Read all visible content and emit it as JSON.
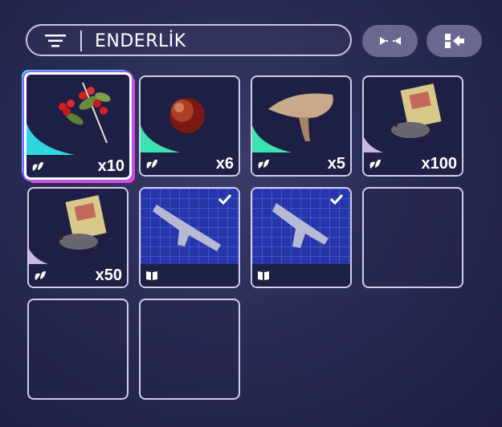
{
  "search": {
    "value": "ENDERLİK"
  },
  "buttons": {
    "collapse_icon": "collapse-arrows-icon",
    "sort_icon": "sort-to-side-icon"
  },
  "items": [
    {
      "name": "red-berries-item",
      "quantity": "x10",
      "category_icon": "leaf-icon",
      "rarity_color": "#2fd6e0",
      "selected": true
    },
    {
      "name": "apple-item",
      "quantity": "x6",
      "category_icon": "leaf-icon",
      "rarity_color": "#3be3b0"
    },
    {
      "name": "mushroom-item",
      "quantity": "x5",
      "category_icon": "leaf-icon",
      "rarity_color": "#3be3b0"
    },
    {
      "name": "seed-packet-item",
      "quantity": "x100",
      "category_icon": "leaf-icon",
      "rarity_color": "#c9b6e8"
    },
    {
      "name": "seed-packet-item",
      "quantity": "x50",
      "category_icon": "leaf-icon",
      "rarity_color": "#c9b6e8"
    },
    {
      "name": "rifle-blueprint-item",
      "quantity": "",
      "category_icon": "book-icon",
      "owned_check": true
    },
    {
      "name": "smg-blueprint-item",
      "quantity": "",
      "category_icon": "book-icon",
      "owned_check": true
    }
  ],
  "empty_slots": 3
}
